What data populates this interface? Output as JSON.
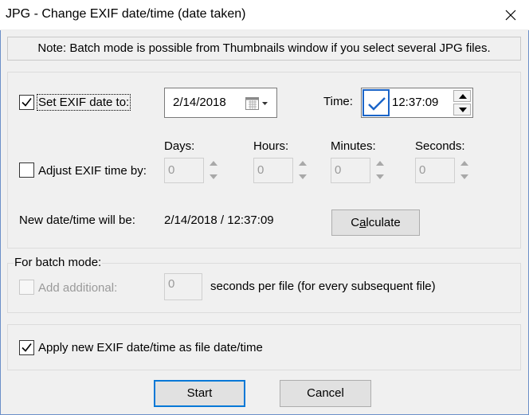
{
  "window": {
    "title": "JPG - Change EXIF date/time (date taken)"
  },
  "note": "Note: Batch mode is possible from Thumbnails window if you select several JPG files.",
  "set_date": {
    "label": "Set EXIF date to:",
    "checked": true,
    "date_value": "2/14/2018"
  },
  "time": {
    "label": "Time:",
    "checked": true,
    "value": "12:37:09"
  },
  "adjust": {
    "label": "Adjust EXIF time by:",
    "checked": false,
    "fields": [
      {
        "label": "Days:",
        "value": "0"
      },
      {
        "label": "Hours:",
        "value": "0"
      },
      {
        "label": "Minutes:",
        "value": "0"
      },
      {
        "label": "Seconds:",
        "value": "0"
      }
    ]
  },
  "result": {
    "label": "New date/time will be:",
    "value": "2/14/2018 / 12:37:09"
  },
  "calculate_button": "Calculate",
  "batch": {
    "group_label": "For batch mode:",
    "add_label": "Add additional:",
    "add_checked": false,
    "add_value": "0",
    "suffix": "seconds per file (for every subsequent file)"
  },
  "apply": {
    "label": "Apply new EXIF date/time as file date/time",
    "checked": true
  },
  "buttons": {
    "start": "Start",
    "cancel": "Cancel"
  }
}
